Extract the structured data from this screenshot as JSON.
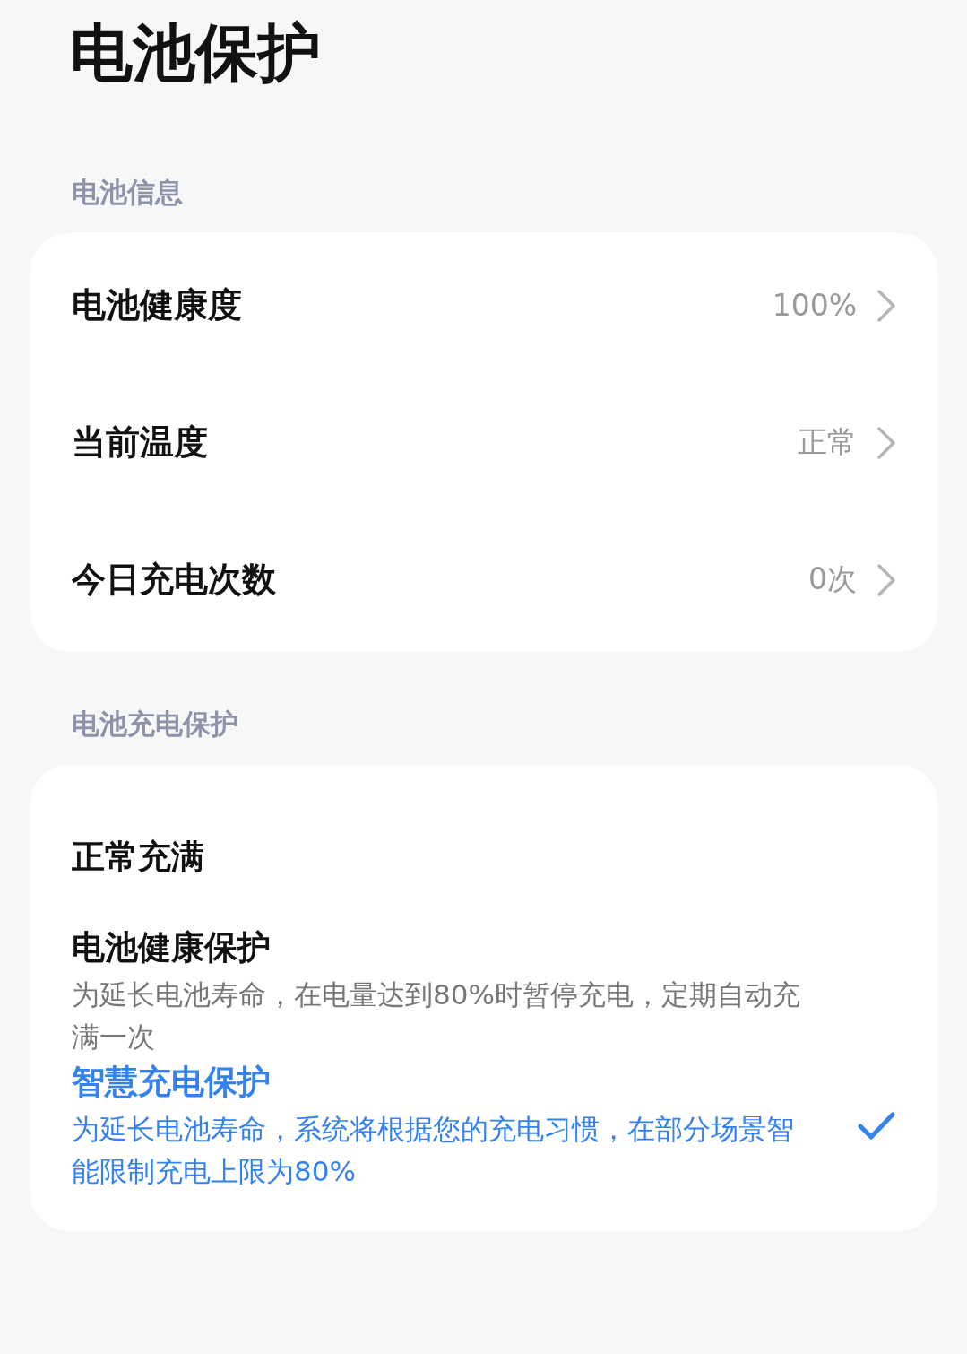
{
  "title": "电池保护",
  "sections": [
    {
      "header": "电池信息",
      "kind": "info",
      "items": [
        {
          "label": "电池健康度",
          "value": "100%"
        },
        {
          "label": "当前温度",
          "value": "正常"
        },
        {
          "label": "今日充电次数",
          "value": "0次"
        }
      ]
    },
    {
      "header": "电池充电保护",
      "kind": "choice",
      "items": [
        {
          "label": "正常充满",
          "selected": false
        },
        {
          "label": "电池健康保护",
          "description": "为延长电池寿命，在电量达到80%时暂停充电，定期自动充满一次",
          "selected": false
        },
        {
          "label": "智慧充电保护",
          "description": "为延长电池寿命，系统将根据您的充电习惯，在部分场景智能限制充电上限为80%",
          "selected": true
        }
      ]
    }
  ]
}
